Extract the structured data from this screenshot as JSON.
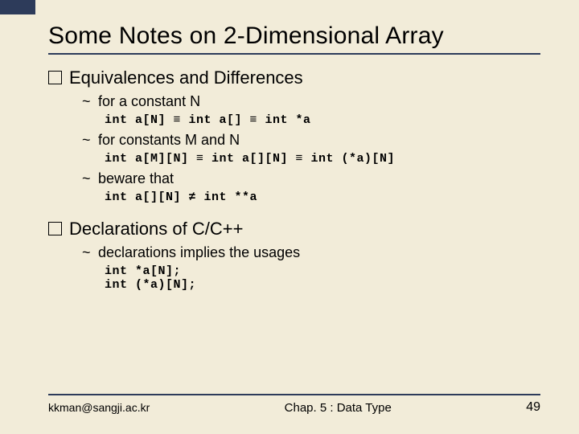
{
  "title": "Some Notes on 2-Dimensional Array",
  "sections": [
    {
      "heading": "Equivalences and Differences",
      "items": [
        {
          "label": "for a constant N",
          "code": "int a[N] ≡ int a[] ≡ int *a"
        },
        {
          "label": "for constants M and N",
          "code": "int a[M][N] ≡ int a[][N] ≡ int (*a)[N]"
        },
        {
          "label": "beware that",
          "code": "int a[][N] ≠ int **a"
        }
      ]
    },
    {
      "heading": "Declarations of C/C++",
      "items": [
        {
          "label": "declarations implies the usages",
          "code": "int *a[N];\nint (*a)[N];"
        }
      ]
    }
  ],
  "footer": {
    "left": "kkman@sangji.ac.kr",
    "center": "Chap. 5 : Data Type",
    "right": "49"
  }
}
